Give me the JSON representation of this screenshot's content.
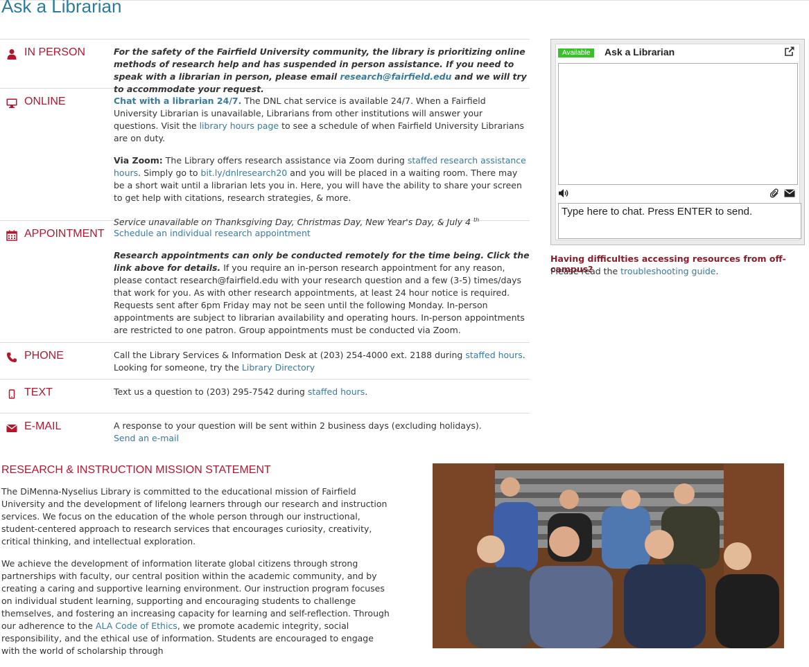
{
  "page": {
    "title": "Ask a Librarian"
  },
  "in_person": {
    "label": "IN PERSON",
    "text_a": "For the safety of the Fairfield University community, the library is prioritizing online methods of research help and has suspended in person assistance. If you need to speak with a librarian in person, please email ",
    "email": "research@fairfield.edu",
    "text_b": " and we will try to accommodate your request."
  },
  "online": {
    "label": "ONLINE",
    "chat_link": "Chat with a librarian 24/7.",
    "chat_text_a": "  The DNL chat service is available 24/7. When a Fairfield University Librarian is unavailable, Librarians from other institutions will answer your questions. Visit the ",
    "hours_link": "library hours page",
    "chat_text_b": " to see a schedule of when Fairfield University Librarians are on duty.",
    "zoom_label": "Via Zoom:",
    "zoom_text_a": " The Library offers research assistance via Zoom during ",
    "zoom_link": "staffed research assistance hours",
    "zoom_text_b": ". Simply go to ",
    "zoom_url": "bit.ly/dnlresearch20",
    "zoom_text_c": " and you will be placed in a waiting room. There may be a short wait until a librarian lets you in. Here, you will have the ability to share your screen to get help with citations, research strategies, & more.",
    "unavailable": "Service unavailable on Thanksgiving Day, Christmas Day, New Year's Day, & July 4",
    "unavailable_sup": "th"
  },
  "appointment": {
    "label": "APPOINTMENT",
    "link": "Schedule an individual research appointment",
    "bold": "Research appointments can only be conducted remotely for the time being. Click the link above for details.",
    "text": " If you require an in-person research appointment for any reason, please contact research@fairfield.edu with your research question and a few (3-5) times/days that work for you. As with other research appointments, at least 24 hour notice is required. Requests sent after 6pm Friday may not be seen until the following Monday. In-person appointments are subject to librarian availability and operating hours. In-person appointments are restricted to one patron. Group appointments must be conducted via Zoom."
  },
  "phone": {
    "label": "PHONE",
    "text_a": "Call the Library Services & Information Desk at (203) 254-4000 ext. 2188 during ",
    "hours_link": "staffed hours",
    "text_b": ".",
    "text_c": "Looking for someone, try the  ",
    "directory_link": "Library Directory"
  },
  "text_msg": {
    "label": "TEXT",
    "text_a": "Text us a question to  (203) 295-7542 during ",
    "hours_link": "staffed hours",
    "text_b": "."
  },
  "email": {
    "label": "E-MAIL",
    "text": "A response to your question will be sent within 2 business days (excluding holidays).",
    "link": "Send an e-mail"
  },
  "chat_widget": {
    "status": "Available",
    "title": "Ask a Librarian",
    "input_placeholder": "Type here to chat. Press ENTER to send."
  },
  "offcampus": {
    "question": "Having difficulties accessing resources from off-campus?",
    "text_a": "Please read the ",
    "link": "troubleshooting guide",
    "text_b": "."
  },
  "mission": {
    "title": "RESEARCH & INSTRUCTION MISSION STATEMENT",
    "p1": "The DiMenna-Nyselius Library is committed to the educational mission of Fairfield University and the development of lifelong learners through our research and instruction services. We focus on the education of the whole person through our instructional, student-centered approach to research services that encourages curiosity, creativity, critical thinking, and intellectual exploration.",
    "p2_a": "We achieve the development of information literate global citizens through strong partnerships with faculty, our central position within the academic community, and by creating a caring and supportive learning environment. Our instruction program focuses on individual student learning, supporting and encouraging students to challenge themselves, and fostering an increasing capacity for learning and self-reflection. Through our adherence to the ",
    "p2_link": "ALA Code of Ethics",
    "p2_b": ", we promote academic integrity, social responsibility, and the ethical use of information. Students are encouraged to engage with the world of scholarship through"
  },
  "colors": {
    "accent": "#b5162f",
    "link": "#3a7a9a",
    "title": "#2d7a9a",
    "available": "#3cbf2c",
    "offcampus": "#8a1c2b"
  },
  "icons": [
    "user-icon",
    "monitor-icon",
    "calendar-icon",
    "phone-icon",
    "mobile-icon",
    "envelope-icon",
    "popout-icon",
    "sound-icon",
    "paperclip-icon",
    "mail-icon"
  ]
}
